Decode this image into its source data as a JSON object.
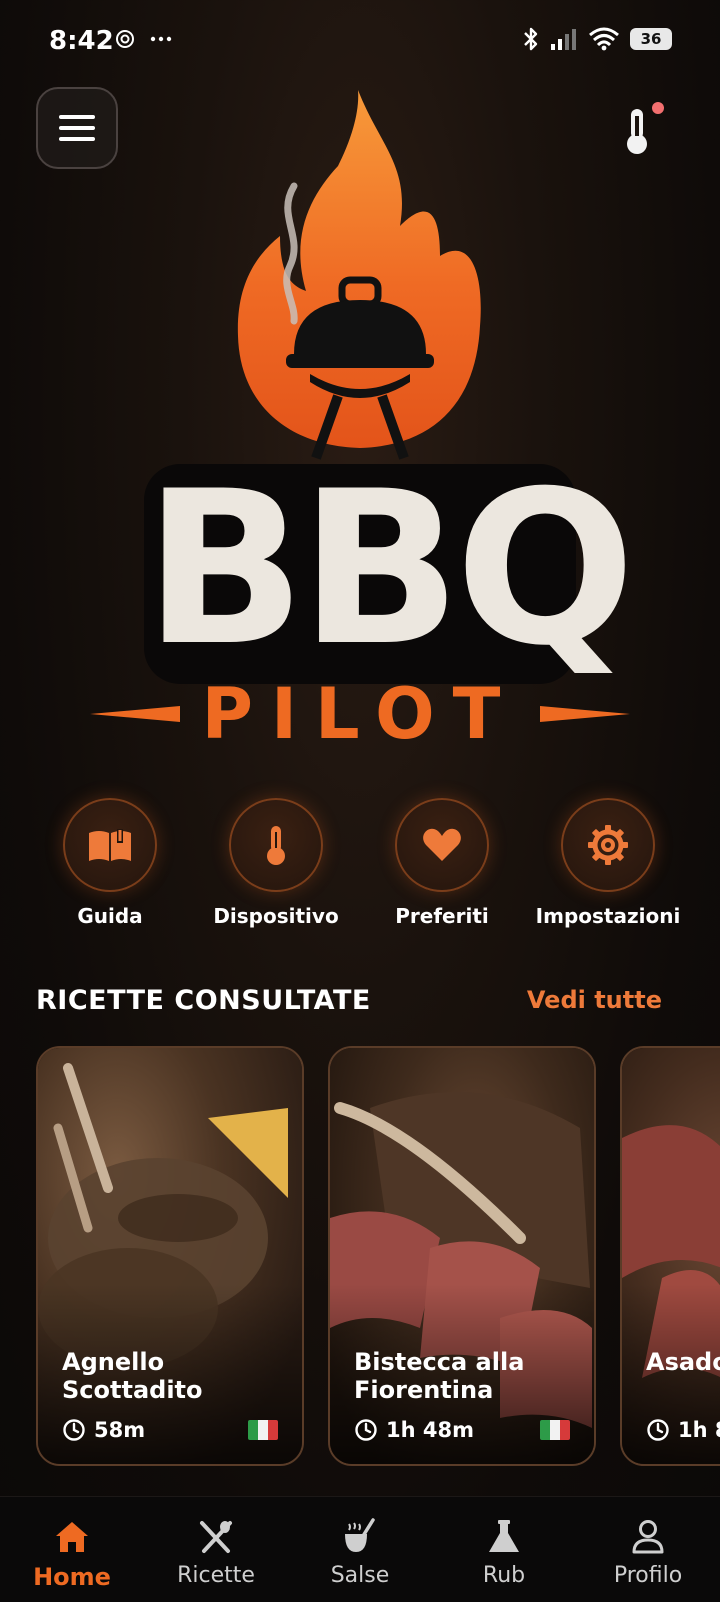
{
  "status_bar": {
    "time": "8:42",
    "battery": "36"
  },
  "logo": {
    "title": "BBQ",
    "subtitle": "PILOT"
  },
  "quick_actions": [
    {
      "label": "Guida",
      "icon": "book-icon"
    },
    {
      "label": "Dispositivo",
      "icon": "thermometer-icon"
    },
    {
      "label": "Preferiti",
      "icon": "heart-icon"
    },
    {
      "label": "Impostazioni",
      "icon": "gear-icon"
    }
  ],
  "recent_recipes": {
    "title": "RICETTE CONSULTATE",
    "see_all": "Vedi tutte",
    "items": [
      {
        "title": "Agnello Scottadito",
        "time": "58m",
        "flag": "italy"
      },
      {
        "title": "Bistecca alla Fiorentina",
        "time": "1h 48m",
        "flag": "italy"
      },
      {
        "title": "Asado",
        "time": "1h 8",
        "flag": ""
      }
    ]
  },
  "bottom_nav": {
    "items": [
      {
        "label": "Home",
        "icon": "home-icon",
        "active": true
      },
      {
        "label": "Ricette",
        "icon": "utensils-icon",
        "active": false
      },
      {
        "label": "Salse",
        "icon": "sauce-icon",
        "active": false
      },
      {
        "label": "Rub",
        "icon": "flask-icon",
        "active": false
      },
      {
        "label": "Profilo",
        "icon": "user-icon",
        "active": false
      }
    ]
  },
  "colors": {
    "accent": "#ee6a22",
    "see_all": "#ee7a3a",
    "background": "#0f0b09"
  }
}
